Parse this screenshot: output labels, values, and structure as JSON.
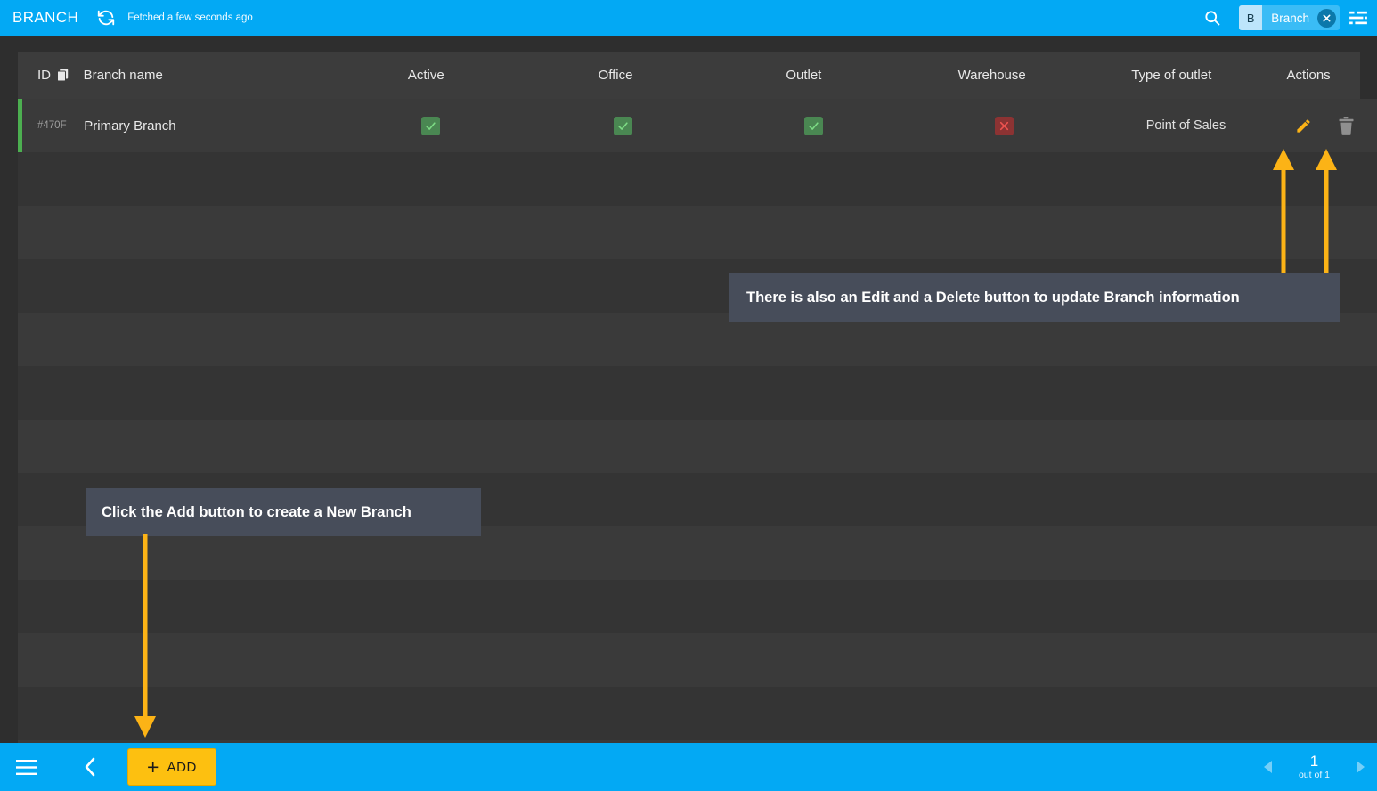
{
  "topbar": {
    "title": "BRANCH",
    "refresh_icon": "refresh-icon",
    "fetched_text": "Fetched a few seconds ago",
    "search_icon": "search-icon",
    "chip": {
      "badge": "B",
      "label": "Branch",
      "close_icon": "close-icon"
    },
    "filter_icon": "filter-icon",
    "accent_color": "#03a9f4"
  },
  "table": {
    "columns": [
      {
        "key": "id",
        "label": "ID",
        "icon": "copy-icon"
      },
      {
        "key": "name",
        "label": "Branch name"
      },
      {
        "key": "active",
        "label": "Active"
      },
      {
        "key": "office",
        "label": "Office"
      },
      {
        "key": "outlet",
        "label": "Outlet"
      },
      {
        "key": "warehouse",
        "label": "Warehouse"
      },
      {
        "key": "type",
        "label": "Type of outlet"
      },
      {
        "key": "actions",
        "label": "Actions"
      }
    ],
    "rows": [
      {
        "id": "#470F",
        "name": "Primary Branch",
        "active": true,
        "office": true,
        "outlet": true,
        "warehouse": false,
        "type": "Point of Sales",
        "edit_icon": "pencil-icon",
        "delete_icon": "trash-icon"
      }
    ],
    "empty_row_count": 12,
    "accent_color": "#4caf50",
    "yes_color": "#4a8752",
    "no_color": "#8c3333"
  },
  "callouts": [
    {
      "id": "edit-delete",
      "text": "There is also an Edit and a Delete button to update Branch information"
    },
    {
      "id": "add",
      "text": "Click the Add button to create a New Branch"
    }
  ],
  "annotation_color": "#fcb316",
  "bottombar": {
    "menu_icon": "hamburger-menu-icon",
    "back_icon": "chevron-left-icon",
    "add_button": {
      "plus": "+",
      "label": "ADD"
    },
    "pagination": {
      "prev_icon": "chevron-left-icon",
      "next_icon": "chevron-right-icon",
      "current": "1",
      "total_label": "out of 1"
    }
  }
}
